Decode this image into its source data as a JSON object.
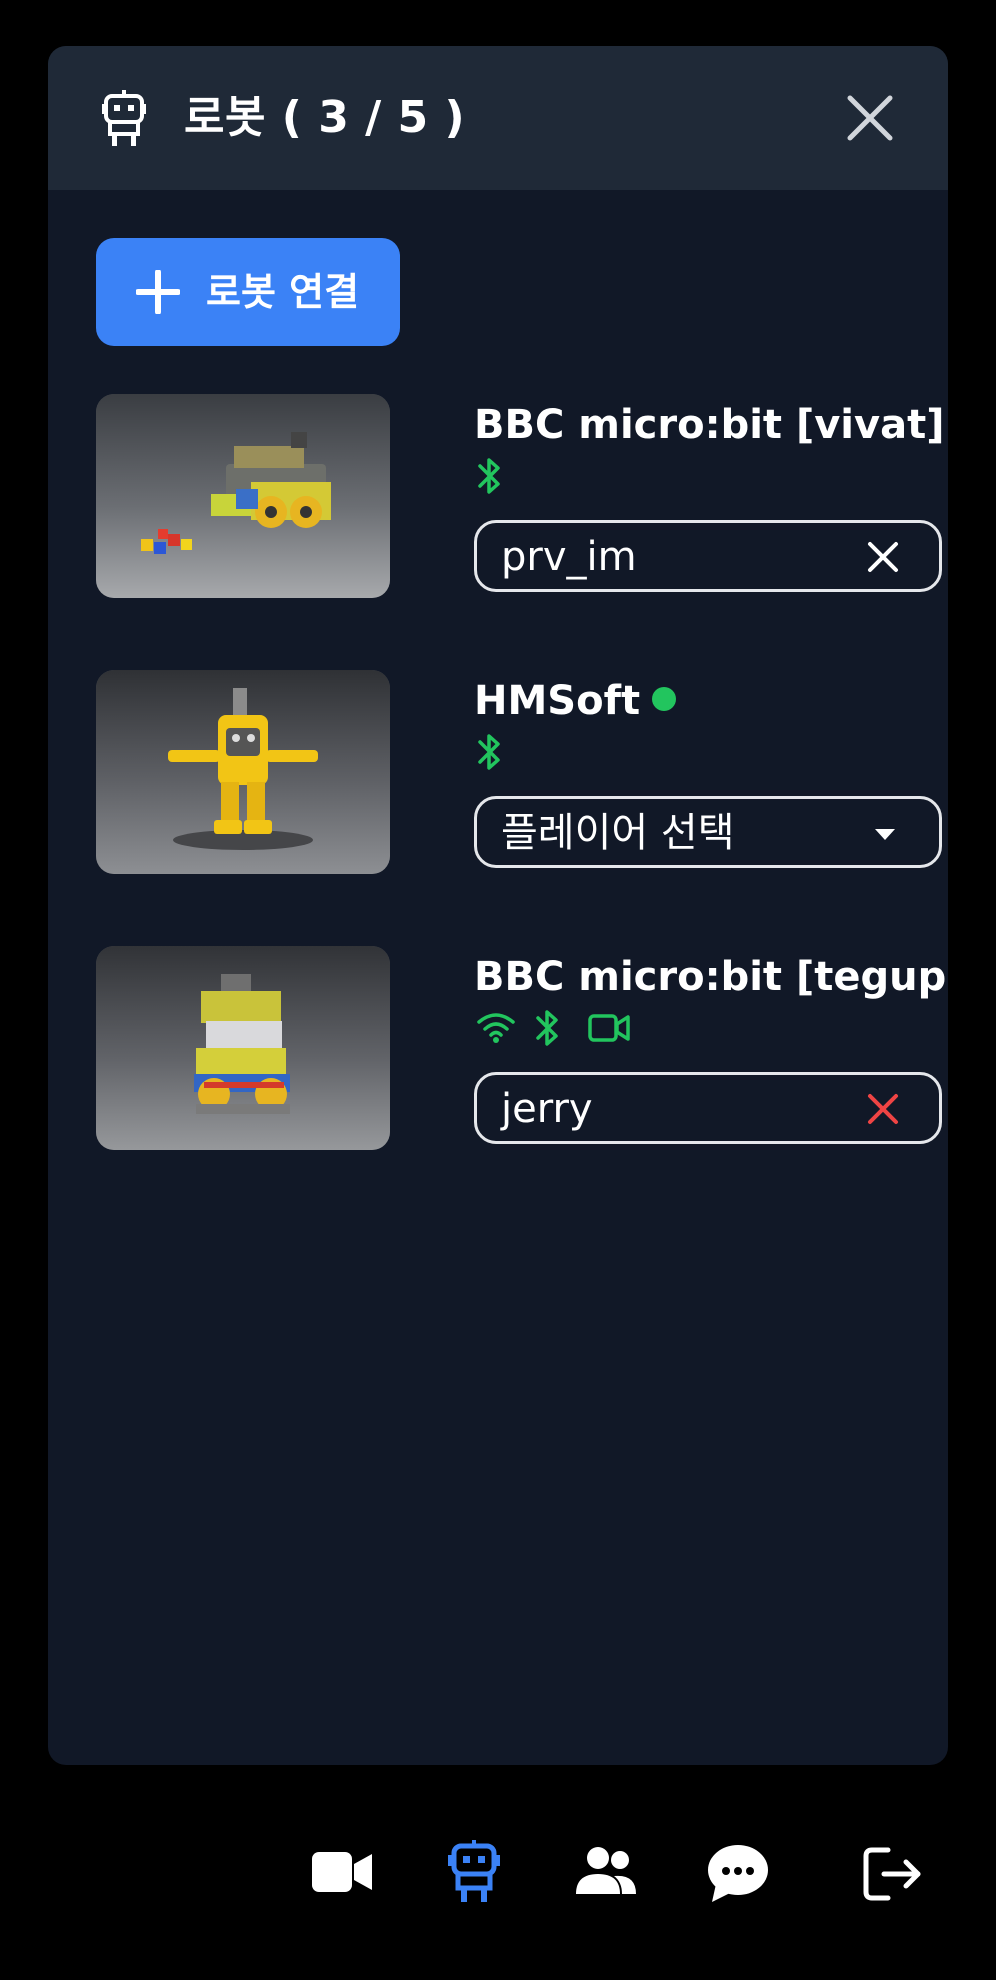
{
  "panel": {
    "title": "로봇 ( 3 / 5 )",
    "connect_button_label": "로봇 연결"
  },
  "robots": [
    {
      "name": "BBC micro:bit [vivat]",
      "status": "online",
      "connections": [
        "bluetooth-icon"
      ],
      "player": "prv_im",
      "player_action": "clear"
    },
    {
      "name": "HMSoft",
      "status": "online",
      "connections": [
        "bluetooth-icon"
      ],
      "player": "플레이어 선택",
      "player_action": "select"
    },
    {
      "name": "BBC micro:bit [tegup]",
      "status": "online",
      "connections": [
        "wifi-icon",
        "bluetooth-icon",
        "video-icon"
      ],
      "player": "jerry",
      "player_action": "clear"
    }
  ],
  "bottom_nav": [
    {
      "name": "video-icon",
      "active": false
    },
    {
      "name": "robot-icon",
      "active": true
    },
    {
      "name": "users-icon",
      "active": false
    },
    {
      "name": "chat-icon",
      "active": false
    },
    {
      "name": "logout-icon",
      "active": false
    }
  ],
  "colors": {
    "background": "#000000",
    "panel": "#111827",
    "header": "#1f2937",
    "accent": "#3b82f6",
    "status_online": "#22c55e",
    "danger": "#ef4444"
  }
}
